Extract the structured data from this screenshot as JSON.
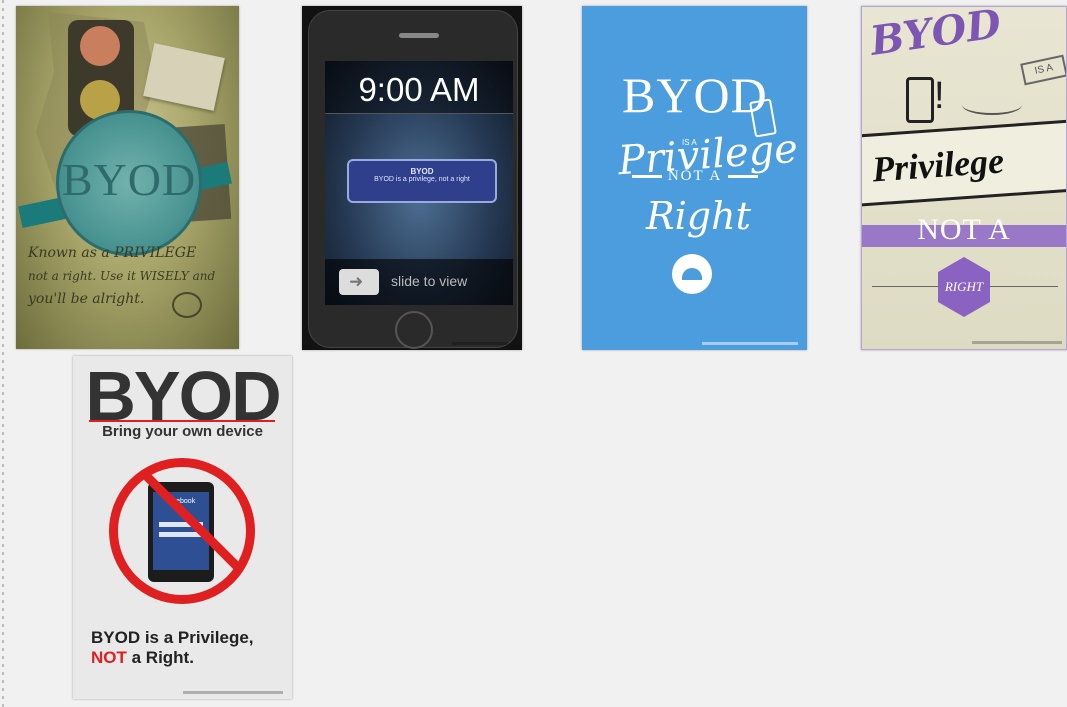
{
  "posters": [
    {
      "id": "traffic-light",
      "main_text": "BYOD",
      "tagline_lines": [
        "Known as a PRIVILEGE",
        "not a right. Use it WISELY and",
        "you'll be alright."
      ]
    },
    {
      "id": "iphone-lockscreen",
      "clock": "9:00 AM",
      "notification_title": "BYOD",
      "notification_body": "BYOD is a privilege, not a right",
      "slider_text": "slide to view"
    },
    {
      "id": "blue-typographic",
      "line1": "BYOD",
      "line2": "IS A",
      "line3": "Privilege",
      "line4": "NOT A",
      "line5": "Right"
    },
    {
      "id": "purple",
      "line1": "BYOD",
      "line2": "IS A",
      "line3": "Privilege",
      "line4": "NOT A",
      "line5": "RIGHT"
    },
    {
      "id": "prohibition",
      "title": "BYOD",
      "subtitle": "Bring your own device",
      "phone_app": "facebook",
      "message_line1": "BYOD is a Privilege,",
      "message_not": "NOT",
      "message_rest": " a Right."
    }
  ],
  "colors": {
    "background": "#f1f1f1",
    "blue_poster": "#4b9ddd",
    "purple_accent": "#8a62c2",
    "prohibition_red": "#e02020"
  }
}
